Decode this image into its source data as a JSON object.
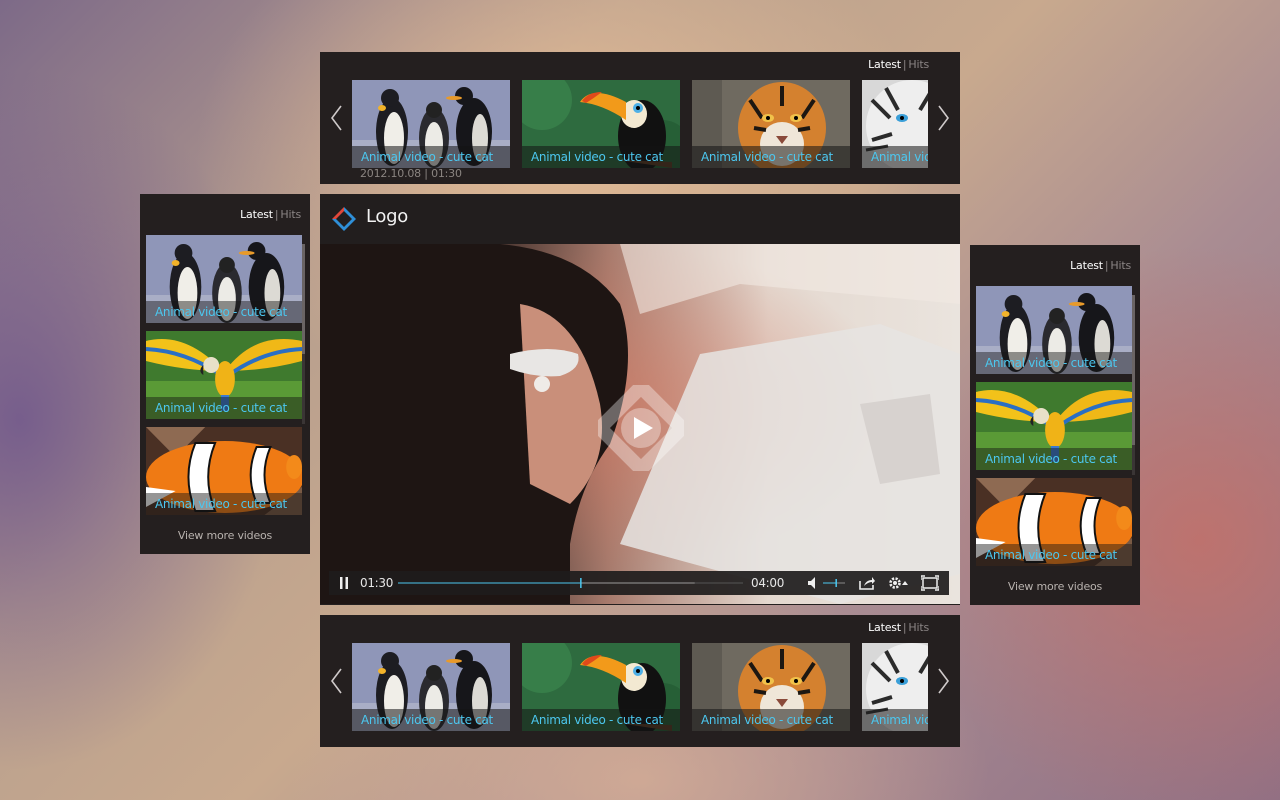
{
  "tabs": {
    "latest": "Latest",
    "separator": "|",
    "hits": "Hits"
  },
  "thumb_label": "Animal video - cute cat",
  "top_strip": {
    "meta": "2012.10.08 | 01:30",
    "items": [
      {
        "label": "Animal video - cute cat",
        "subject": "penguins"
      },
      {
        "label": "Animal video - cute cat",
        "subject": "toucan"
      },
      {
        "label": "Animal video - cute cat",
        "subject": "tiger"
      },
      {
        "label": "Animal video - cute cat",
        "subject": "white-tiger"
      }
    ]
  },
  "bottom_strip": {
    "items": [
      {
        "label": "Animal video - cute cat",
        "subject": "penguins"
      },
      {
        "label": "Animal video - cute cat",
        "subject": "toucan"
      },
      {
        "label": "Animal video - cute cat",
        "subject": "tiger"
      },
      {
        "label": "Animal video - cute cat",
        "subject": "white-tiger"
      }
    ]
  },
  "left_list": {
    "items": [
      {
        "label": "Animal video - cute cat",
        "subject": "penguins"
      },
      {
        "label": "Animal video - cute cat",
        "subject": "parrot"
      },
      {
        "label": "Animal video - cute cat",
        "subject": "clownfish"
      }
    ],
    "view_more": "View more videos"
  },
  "right_list": {
    "items": [
      {
        "label": "Animal video - cute cat",
        "subject": "penguins"
      },
      {
        "label": "Animal video - cute cat",
        "subject": "parrot"
      },
      {
        "label": "Animal video - cute cat",
        "subject": "clownfish"
      }
    ],
    "view_more": "View more videos"
  },
  "player": {
    "logo": "Logo",
    "current_time": "01:30",
    "duration": "04:00",
    "progress": 0.53,
    "buffered": 0.86,
    "volume": 0.6,
    "icons": [
      "pause-icon",
      "volume-icon",
      "share-icon",
      "settings-icon",
      "fullscreen-icon",
      "play-icon"
    ]
  },
  "colors": {
    "panel": "#241f1f",
    "accent_cyan": "#4cc7ef",
    "logo_blue": "#2f8fd8",
    "logo_red": "#e0473a",
    "text_active": "#ffffff",
    "text_muted": "#8b8585"
  }
}
